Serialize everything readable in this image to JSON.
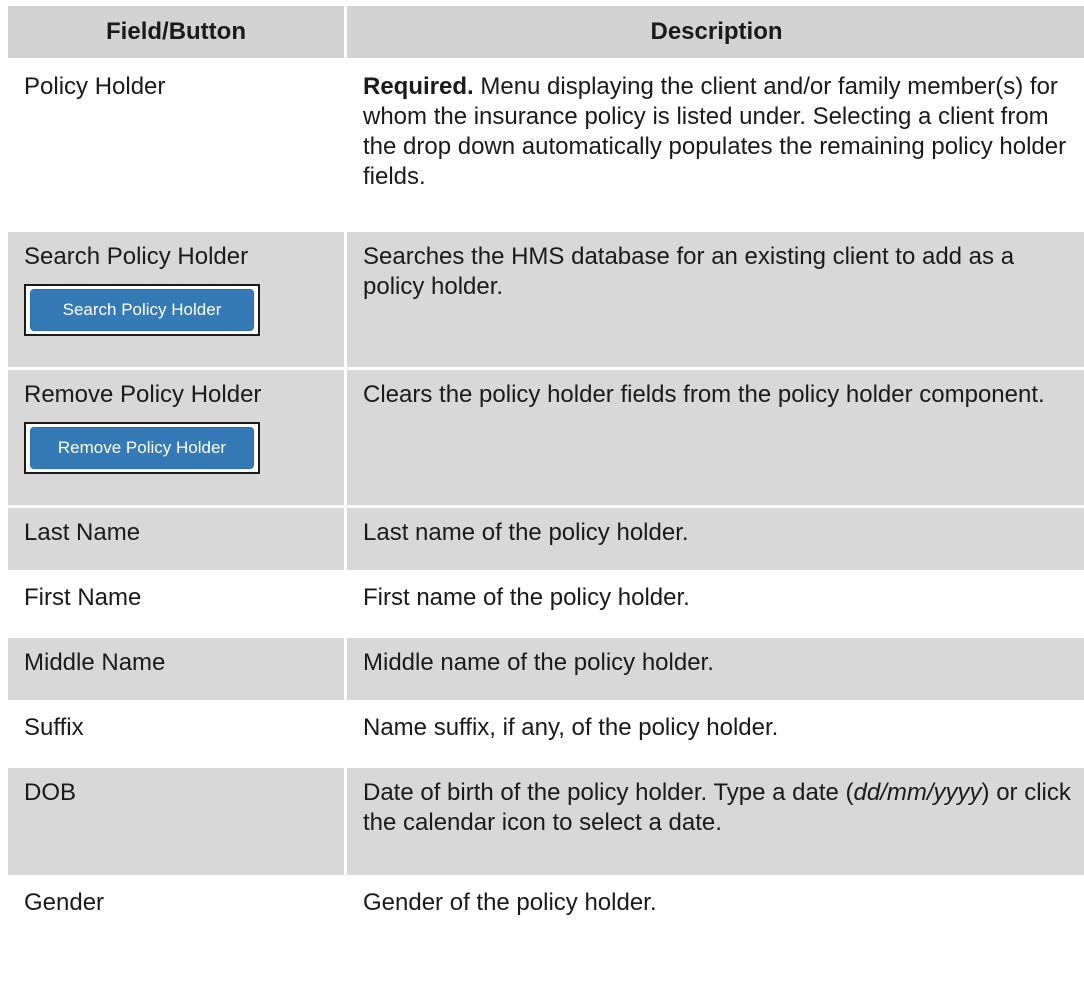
{
  "header": {
    "field": "Field/Button",
    "description": "Description"
  },
  "rows": [
    {
      "field": "Policy Holder",
      "desc_bold": "Required.",
      "desc": " Menu displaying the client and/or family member(s) for whom the insurance policy is listed under. Selecting a client from the drop down automatically populates the remaining policy holder fields."
    },
    {
      "field": "Search Policy Holder",
      "button_label": "Search Policy Holder",
      "desc": "Searches the HMS database for an existing client to add as a policy holder."
    },
    {
      "field": "Remove Policy Holder",
      "button_label": "Remove Policy Holder",
      "desc": "Clears the policy holder fields from the policy holder component."
    },
    {
      "field": "Last Name",
      "desc": "Last name of the policy holder."
    },
    {
      "field": "First Name",
      "desc": "First name of the policy holder."
    },
    {
      "field": "Middle Name",
      "desc": "Middle name of the policy holder."
    },
    {
      "field": "Suffix",
      "desc": "Name suffix, if any, of the policy holder."
    },
    {
      "field": "DOB",
      "desc_pre": "Date of birth of the policy holder. Type a date (",
      "desc_italic": "dd/mm/yyyy",
      "desc_post": ") or click the calendar icon to select a date."
    },
    {
      "field": "Gender",
      "desc": "Gender of the policy holder."
    }
  ],
  "colors": {
    "header_bg": "#d3d3d3",
    "alt_row_bg": "#d8d8d8",
    "button_bg": "#337ab7"
  }
}
